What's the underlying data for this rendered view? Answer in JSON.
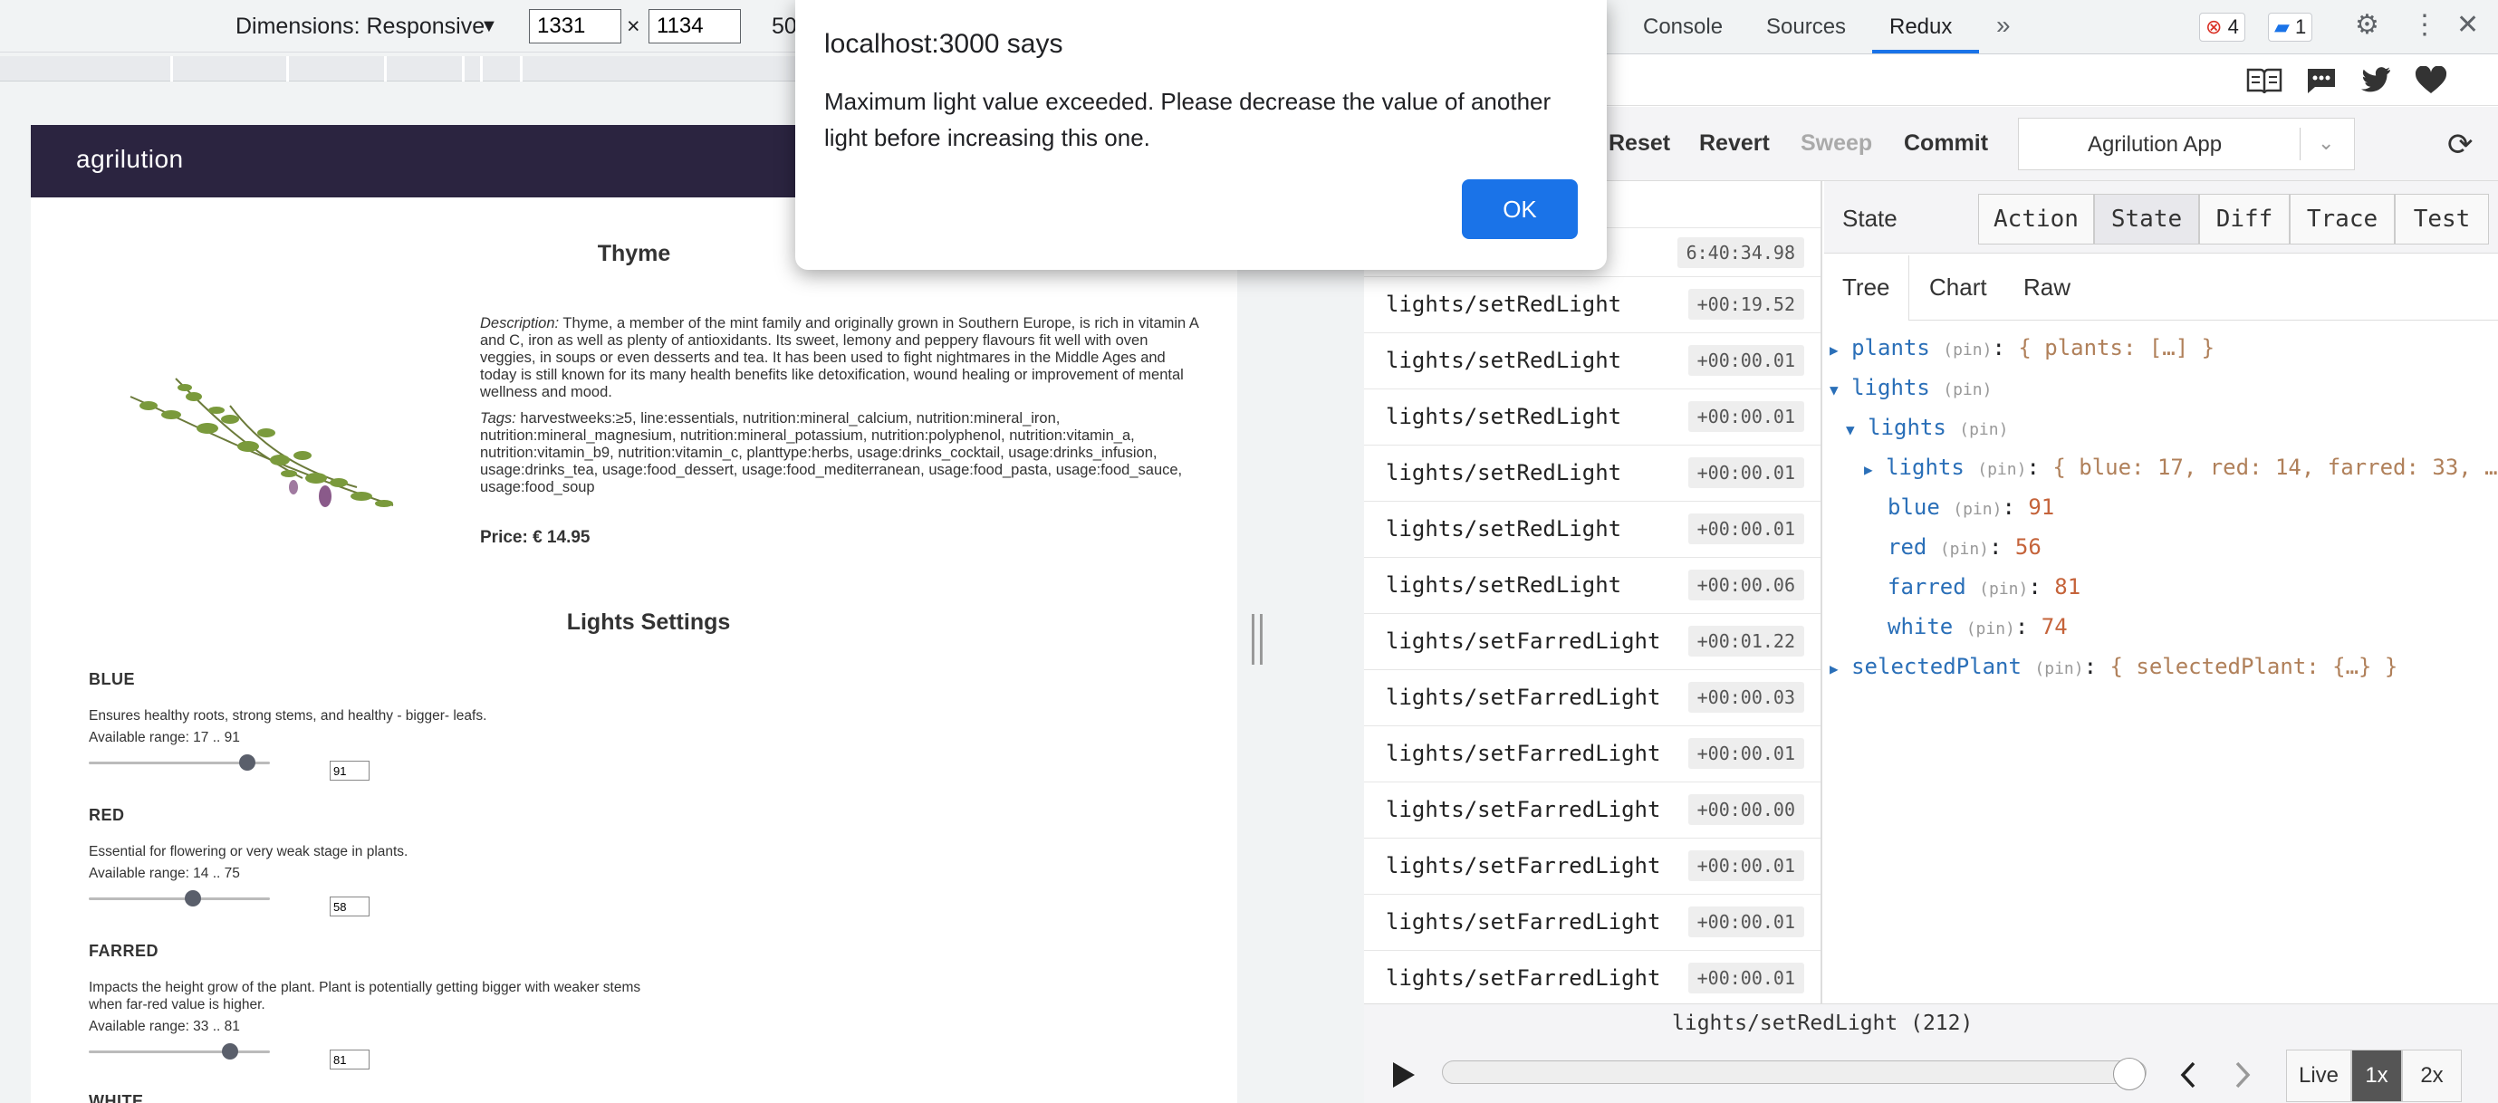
{
  "device_toolbar": {
    "dimensions_label": "Dimensions: Responsive",
    "width": "1331",
    "times": "×",
    "height": "1134",
    "zoom_partial": "50"
  },
  "app": {
    "logo": "agrilution",
    "plant_title": "Thyme",
    "description_label": "Description:",
    "description": " Thyme, a member of the mint family and originally grown in Southern Europe, is rich in vitamin A and C, iron as well as plenty of antioxidants. Its sweet, lemony and peppery flavours fit well with oven veggies, in soups or even desserts and tea. It has been used to fight nightmares in the Middle Ages and today is still known for its many health benefits like detoxification, wound healing or improvement of mental wellness and mood.",
    "tags_label": "Tags:",
    "tags": " harvestweeks:≥5, line:essentials, nutrition:mineral_calcium, nutrition:mineral_iron, nutrition:mineral_magnesium, nutrition:mineral_potassium, nutrition:polyphenol, nutrition:vitamin_a, nutrition:vitamin_b9, nutrition:vitamin_c, planttype:herbs, usage:drinks_cocktail, usage:drinks_infusion, usage:drinks_tea, usage:food_dessert, usage:food_mediterranean, usage:food_pasta, usage:food_sauce, usage:food_soup",
    "price": "Price: € 14.95",
    "lights_title": "Lights Settings",
    "lights": [
      {
        "name": "BLUE",
        "desc": "Ensures healthy roots, strong stems, and healthy - bigger- leafs.",
        "range": "Available range: 17 .. 91",
        "value": "91",
        "min": 17,
        "max": 91,
        "level": 91
      },
      {
        "name": "RED",
        "desc": "Essential for flowering or very weak stage in plants.",
        "range": "Available range: 14 .. 75",
        "value": "58",
        "min": 14,
        "max": 75,
        "level": 58
      },
      {
        "name": "FARRED",
        "desc": "Impacts the height grow of the plant. Plant is potentially getting bigger with weaker stems when far-red value is higher.",
        "range": "Available range: 33 .. 81",
        "value": "81",
        "min": 33,
        "max": 81,
        "level": 81
      },
      {
        "name": "WHITE",
        "desc": "",
        "range": "",
        "value": ""
      }
    ]
  },
  "dialog": {
    "title": "localhost:3000 says",
    "message": "Maximum light value exceeded. Please decrease the value of another light before increasing this one.",
    "ok": "OK"
  },
  "devtools": {
    "tabs": [
      "Console",
      "Sources",
      "Redux"
    ],
    "more": "»",
    "errors": "4",
    "messages": "1",
    "toolbar": {
      "reset": "Reset",
      "revert": "Revert",
      "sweep": "Sweep",
      "commit": "Commit",
      "app": "Agrilution App"
    },
    "first_time": "6:40:34.98",
    "actions": [
      {
        "name": "lights/setRedLight",
        "time": "+00:19.52"
      },
      {
        "name": "lights/setRedLight",
        "time": "+00:00.01"
      },
      {
        "name": "lights/setRedLight",
        "time": "+00:00.01"
      },
      {
        "name": "lights/setRedLight",
        "time": "+00:00.01"
      },
      {
        "name": "lights/setRedLight",
        "time": "+00:00.01"
      },
      {
        "name": "lights/setRedLight",
        "time": "+00:00.06"
      },
      {
        "name": "lights/setFarredLight",
        "time": "+00:01.22"
      },
      {
        "name": "lights/setFarredLight",
        "time": "+00:00.03"
      },
      {
        "name": "lights/setFarredLight",
        "time": "+00:00.01"
      },
      {
        "name": "lights/setFarredLight",
        "time": "+00:00.00"
      },
      {
        "name": "lights/setFarredLight",
        "time": "+00:00.01"
      },
      {
        "name": "lights/setFarredLight",
        "time": "+00:00.01"
      },
      {
        "name": "lights/setFarredLight",
        "time": "+00:00.01"
      }
    ],
    "inspector": {
      "state_label": "State",
      "buttons": [
        "Action",
        "State",
        "Diff",
        "Trace",
        "Test"
      ],
      "subtabs": [
        "Tree",
        "Chart",
        "Raw"
      ],
      "pin": "(pin)",
      "tree": {
        "plants_key": "plants",
        "plants_val": "{ plants: […] }",
        "lights_key": "lights",
        "lights_inner_key": "lights",
        "lights_nested_key": "lights",
        "lights_nested_val": "{ blue: 17, red: 14, farred: 33, …",
        "blue_key": "blue",
        "blue_val": "91",
        "red_key": "red",
        "red_val": "56",
        "farred_key": "farred",
        "farred_val": "81",
        "white_key": "white",
        "white_val": "74",
        "selected_key": "selectedPlant",
        "selected_val": "{ selectedPlant: {…} }"
      }
    },
    "footer": {
      "current": "lights/setRedLight (212)",
      "live": "Live",
      "x1": "1x",
      "x2": "2x",
      "progress": 1.0
    }
  }
}
